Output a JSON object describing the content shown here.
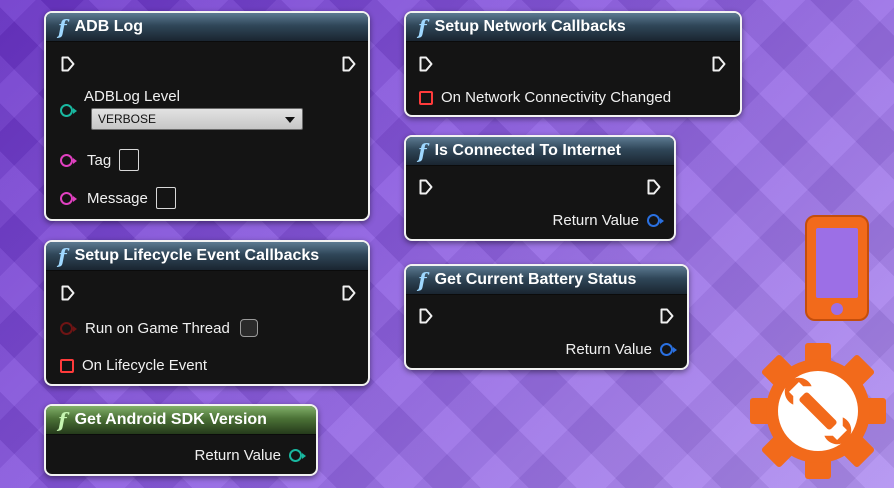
{
  "nodes": {
    "adb_log": {
      "title": "ADB Log",
      "level_label": "ADBLog Level",
      "level_value": "VERBOSE",
      "tag_label": "Tag",
      "message_label": "Message"
    },
    "lifecycle": {
      "title": "Setup Lifecycle Event Callbacks",
      "run_label": "Run on Game Thread",
      "event_label": "On Lifecycle Event"
    },
    "sdk_version": {
      "title": "Get Android SDK Version",
      "return_label": "Return Value"
    },
    "network": {
      "title": "Setup Network Callbacks",
      "event_label": "On Network Connectivity Changed"
    },
    "internet": {
      "title": "Is Connected To Internet",
      "return_label": "Return Value"
    },
    "battery": {
      "title": "Get Current Battery Status",
      "return_label": "Return Value"
    }
  },
  "icons": {
    "function": "function-icon",
    "exec": "exec-pin-icon",
    "phone": "phone-icon",
    "settings": "gear-wrench-icon"
  },
  "colors": {
    "accent_orange": "#f26a1b",
    "pin_teal": "#19b8a0",
    "pin_magenta": "#e040c0",
    "pin_blue": "#2a70e0",
    "delegate_red": "#ff3b3b"
  }
}
